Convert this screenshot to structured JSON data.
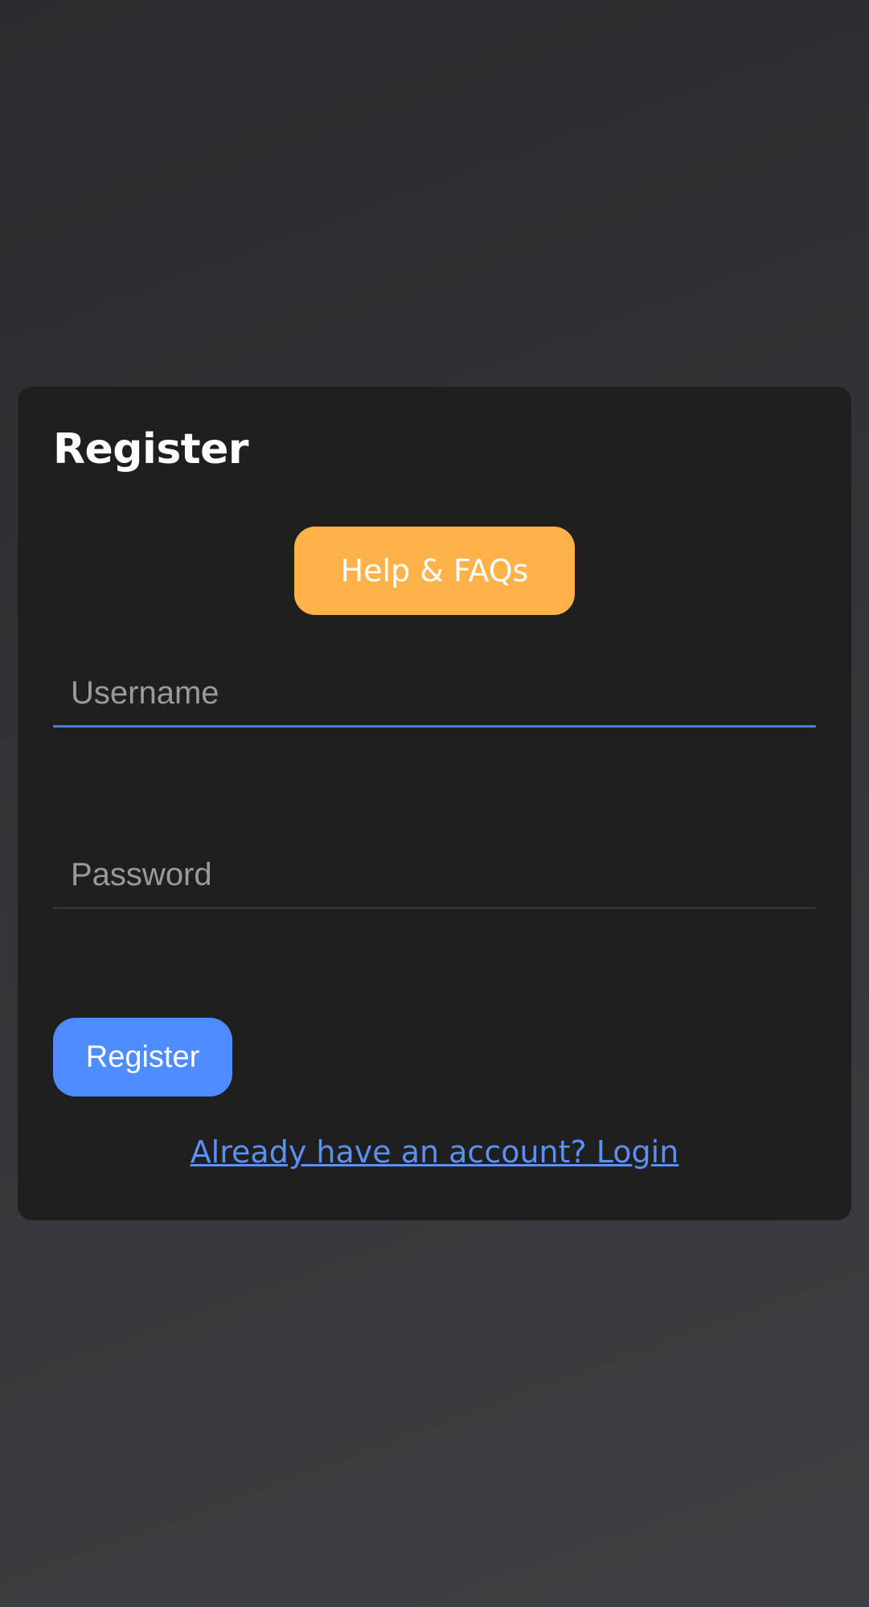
{
  "form": {
    "title": "Register",
    "help_label": "Help & FAQs",
    "username": {
      "value": "",
      "placeholder": "Username"
    },
    "password": {
      "value": "",
      "placeholder": "Password"
    },
    "submit_label": "Register",
    "login_link": "Already have an account? Login"
  },
  "colors": {
    "help_button": "#ffb14a",
    "primary_button": "#4f8cff",
    "link": "#5b8ff0",
    "focus_underline": "#4a7fe0",
    "card": "#1f1f1f"
  }
}
